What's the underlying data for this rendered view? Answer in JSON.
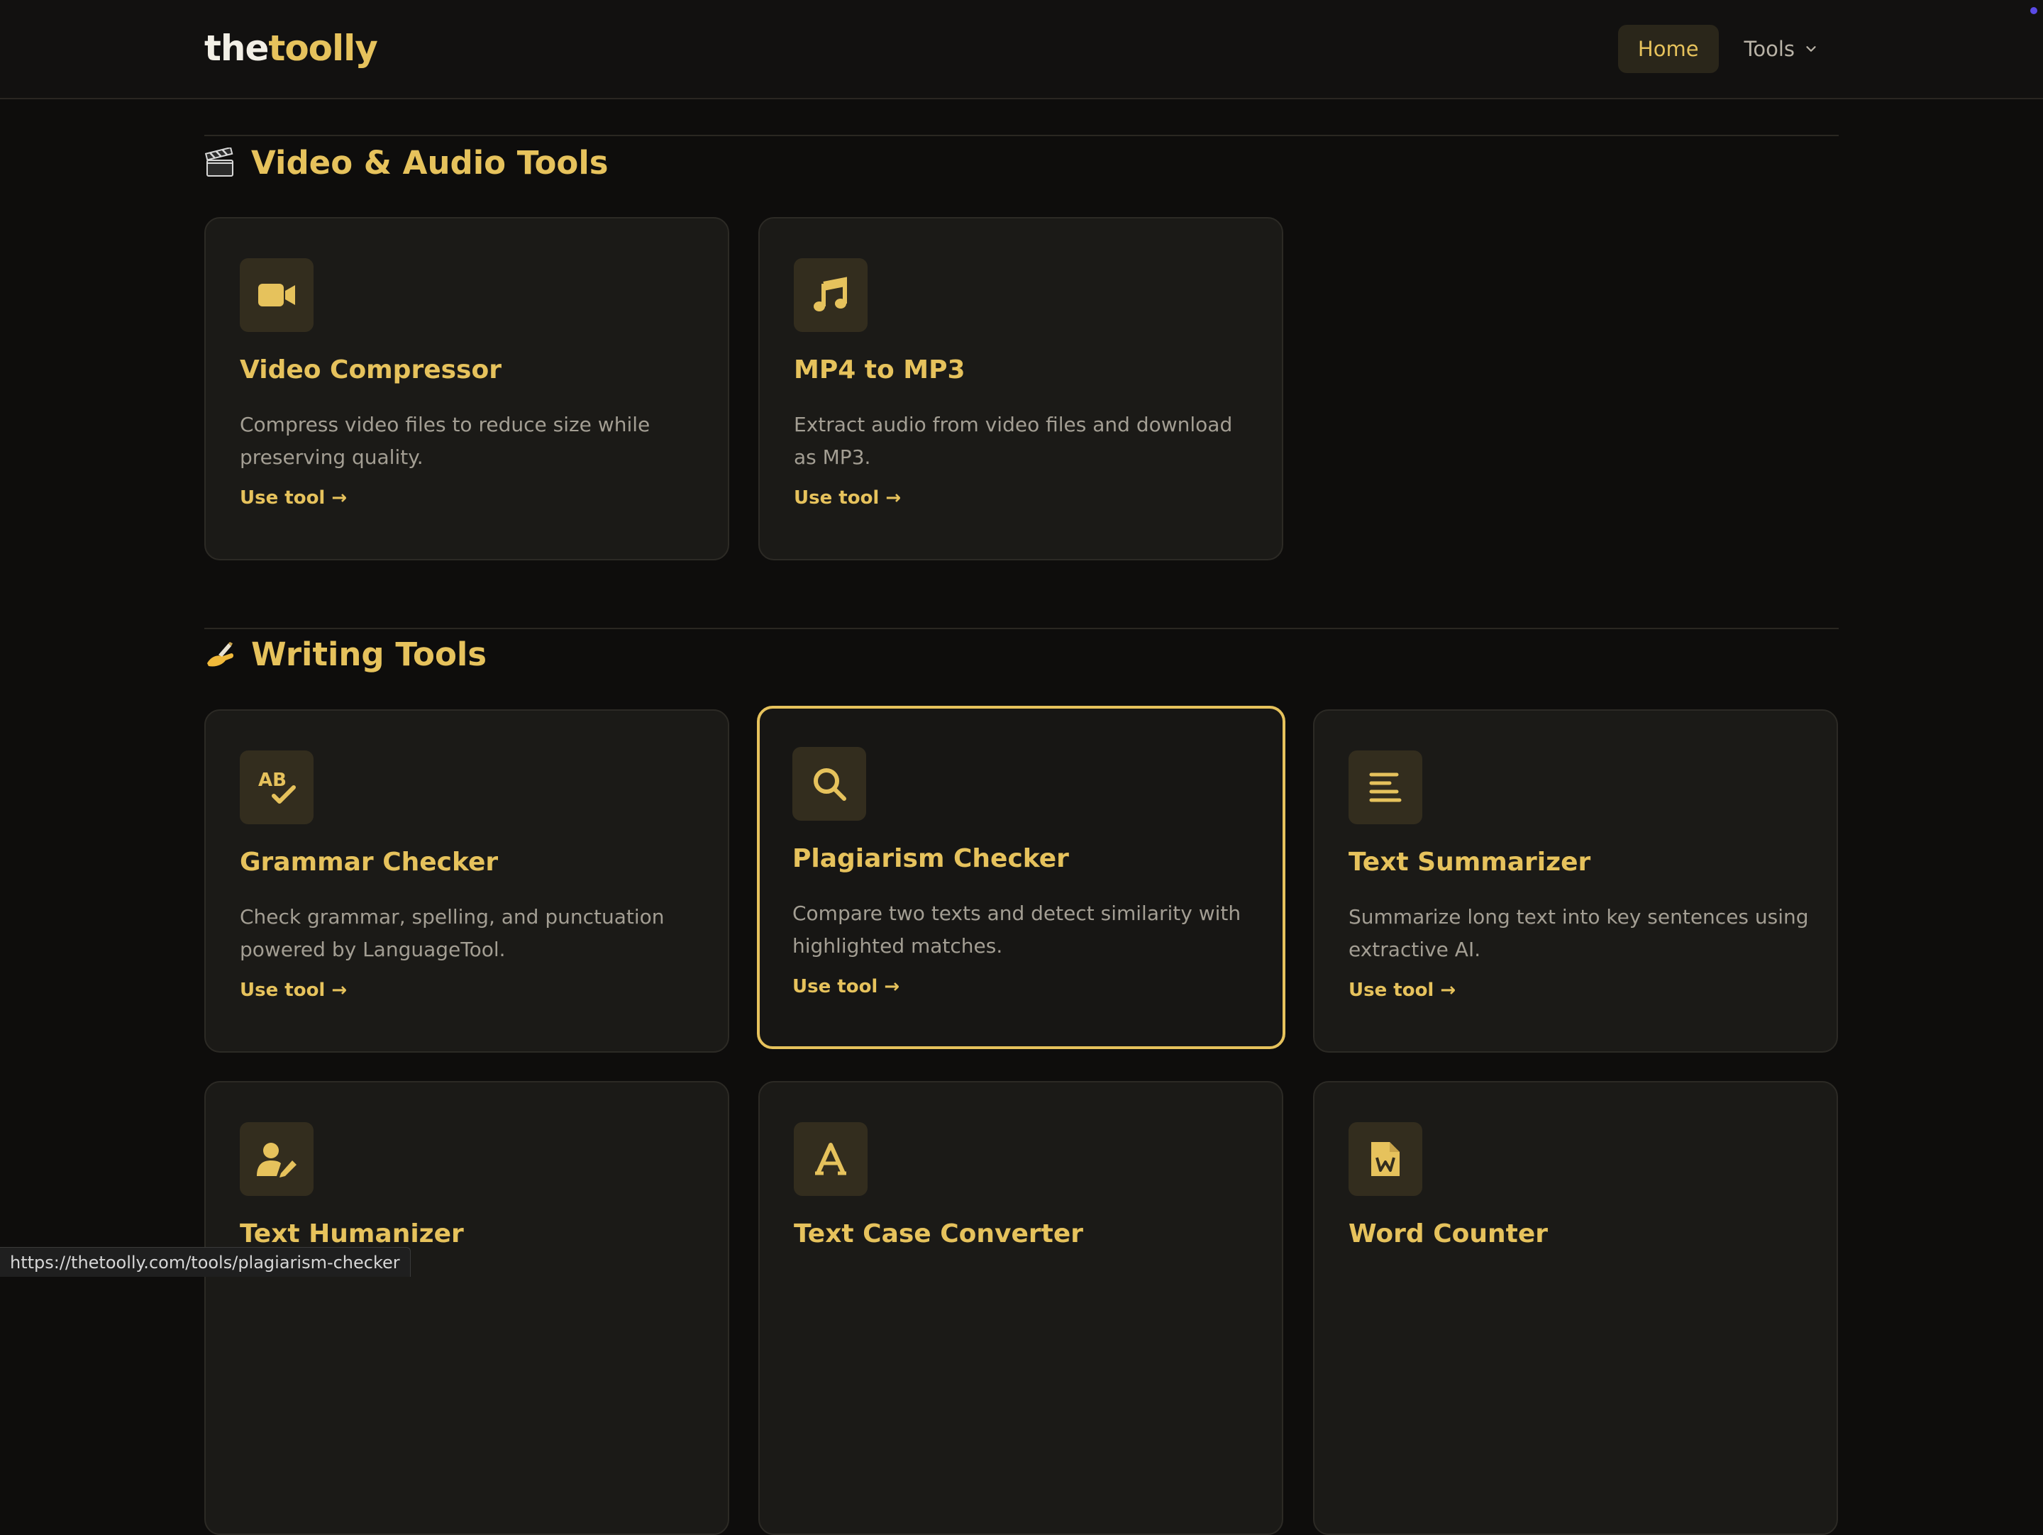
{
  "header": {
    "brand_the": "the",
    "brand_toolly": "toolly",
    "nav_home": "Home",
    "nav_tools": "Tools"
  },
  "sections": {
    "video_audio": {
      "title": "Video & Audio Tools",
      "emoji": "clapper-icon",
      "cards": [
        {
          "title": "Video Compressor",
          "desc": "Compress video files to reduce size while preserving quality.",
          "link": "Use tool →",
          "icon": "video-camera-icon"
        },
        {
          "title": "MP4 to MP3",
          "desc": "Extract audio from video files and download as MP3.",
          "link": "Use tool →",
          "icon": "music-note-icon"
        }
      ]
    },
    "writing": {
      "title": "Writing Tools",
      "emoji": "writing-hand-icon",
      "cards": [
        {
          "title": "Grammar Checker",
          "desc": "Check grammar, spelling, and punctuation powered by LanguageTool.",
          "link": "Use tool →",
          "icon": "spell-check-icon"
        },
        {
          "title": "Plagiarism Checker",
          "desc": "Compare two texts and detect similarity with highlighted matches.",
          "link": "Use tool  →",
          "icon": "search-icon"
        },
        {
          "title": "Text Summarizer",
          "desc": "Summarize long text into key sentences using extractive AI.",
          "link": "Use tool →",
          "icon": "align-left-icon"
        },
        {
          "title": "Text Humanizer",
          "icon": "user-pen-icon"
        },
        {
          "title": "Text Case Converter",
          "icon": "font-a-icon"
        },
        {
          "title": "Word Counter",
          "icon": "word-file-icon"
        }
      ]
    }
  },
  "status_bar": {
    "url": "https://thetoolly.com/tools/plagiarism-checker"
  },
  "colors": {
    "accent": "#e6c25c",
    "background": "#0e0d0c",
    "card": "#1b1a17"
  }
}
